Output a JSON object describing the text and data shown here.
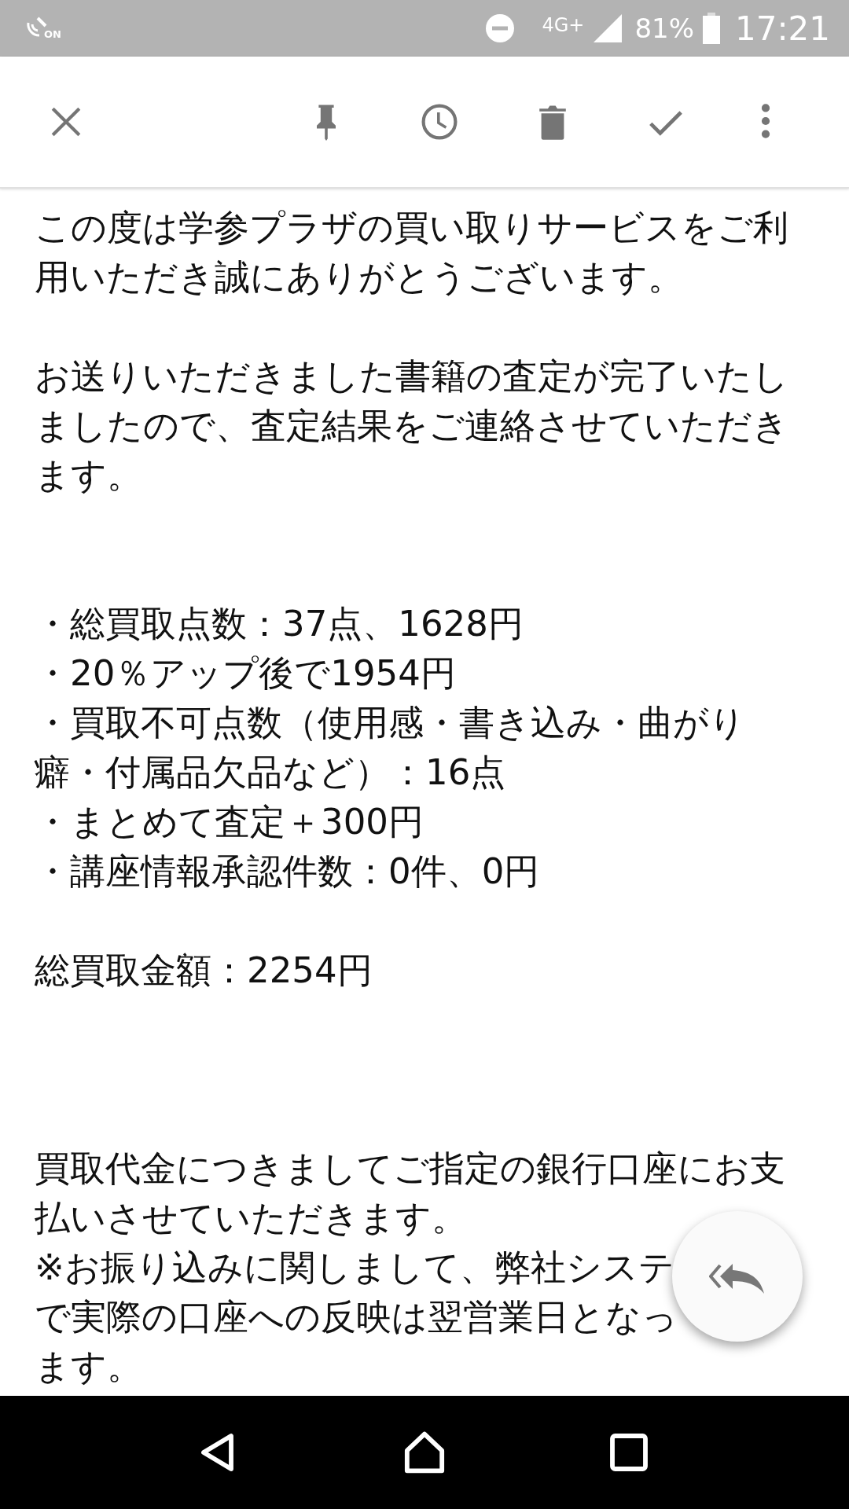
{
  "status_bar": {
    "nfc_label": "ON",
    "network": "4G+",
    "battery": "81%",
    "time": "17:21"
  },
  "toolbar": {
    "actions": [
      {
        "kind": "close"
      },
      {
        "kind": "pin"
      },
      {
        "kind": "snooze"
      },
      {
        "kind": "delete"
      },
      {
        "kind": "done"
      },
      {
        "kind": "more"
      }
    ]
  },
  "body": {
    "blocks": [
      {
        "kind": "paragraph",
        "lines": [
          "この度は学参プラザの買い取りサービスをご利",
          "用いただき誠にありがとうございます。"
        ]
      },
      {
        "kind": "paragraph",
        "lines": [
          "お送りいただきました書籍の査定が完了いたし",
          "ましたので、査定結果をご連絡させていただき",
          "ます。"
        ]
      },
      {
        "kind": "list",
        "items": [
          {
            "lines": [
              "・総買取点数：37点、1628円"
            ]
          },
          {
            "lines": [
              "・20％アップ後で1954円"
            ]
          },
          {
            "lines": [
              "・買取不可点数（使用感・書き込み・曲がり",
              "癖・付属品欠品など）：16点"
            ]
          },
          {
            "lines": [
              "・まとめて査定＋300円"
            ]
          },
          {
            "lines": [
              "・講座情報承認件数：0件、0円"
            ]
          }
        ]
      },
      {
        "kind": "paragraph",
        "lines": [
          "総買取金額：2254円"
        ]
      },
      {
        "kind": "paragraph",
        "lines": [
          "買取代金につきましてご指定の銀行口座にお支",
          "払いさせていただきます。"
        ]
      },
      {
        "kind": "occluded",
        "lines": [
          {
            "text": "※お振り込みに関しまして、弊社システ"
          },
          {
            "text": "で実際の口座への反映は翌営業日となっ"
          },
          {
            "text": "ます。"
          }
        ]
      }
    ]
  },
  "fab": {
    "kind": "reply_all"
  },
  "nav_bar": {
    "buttons": [
      {
        "kind": "back"
      },
      {
        "kind": "home"
      },
      {
        "kind": "recents"
      }
    ]
  }
}
